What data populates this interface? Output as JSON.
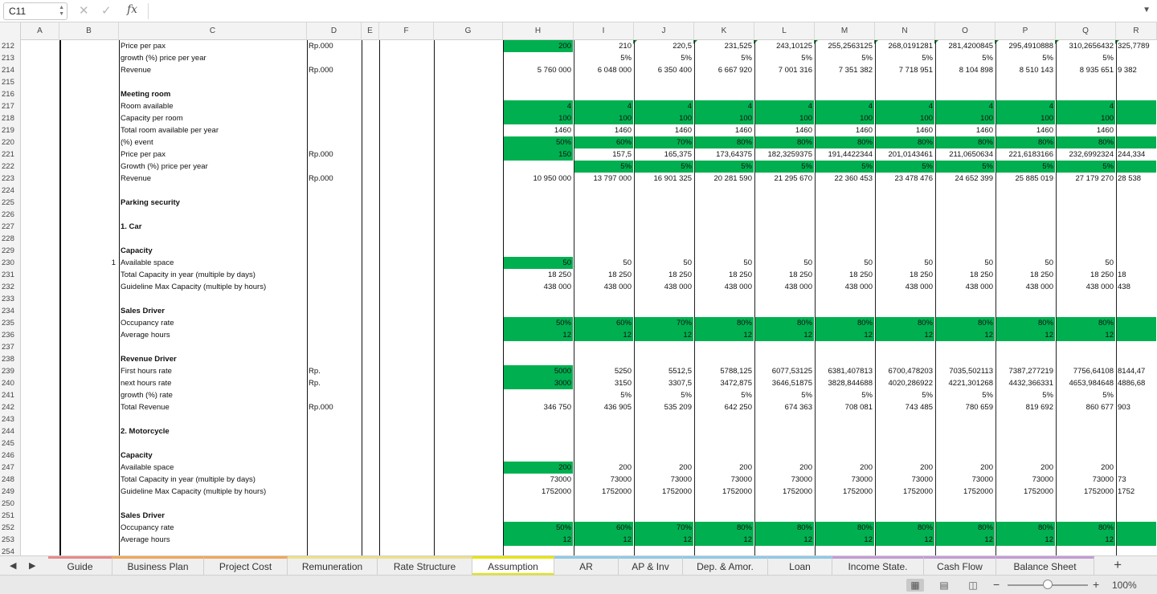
{
  "formula_bar": {
    "name_box": "C11",
    "formula": ""
  },
  "columns": [
    "A",
    "B",
    "C",
    "D",
    "E",
    "F",
    "G",
    "H",
    "I",
    "J",
    "K",
    "L",
    "M",
    "N",
    "O",
    "P",
    "Q",
    "R"
  ],
  "rows": [
    {
      "n": "212",
      "c": "Price per pax",
      "d": "Rp.000",
      "v": [
        "200",
        "210",
        "220,5",
        "231,525",
        "243,10125",
        "255,2563125",
        "268,0191281",
        "281,4200845",
        "295,4910888",
        "310,2656432",
        "325,7789"
      ],
      "g": [
        0
      ]
    },
    {
      "n": "213",
      "c": "growth (%) price per year",
      "v": [
        "",
        "5%",
        "5%",
        "5%",
        "5%",
        "5%",
        "5%",
        "5%",
        "5%",
        "5%",
        ""
      ]
    },
    {
      "n": "214",
      "c": "Revenue",
      "d": "Rp.000",
      "v": [
        "5 760 000",
        "6 048 000",
        "6 350 400",
        "6 667 920",
        "7 001 316",
        "7 351 382",
        "7 718 951",
        "8 104 898",
        "8 510 143",
        "8 935 651",
        "9 382"
      ]
    },
    {
      "n": "215"
    },
    {
      "n": "216",
      "c": "Meeting room",
      "bold": true
    },
    {
      "n": "217",
      "c": "Room available",
      "v": [
        "4",
        "4",
        "4",
        "4",
        "4",
        "4",
        "4",
        "4",
        "4",
        "4",
        ""
      ],
      "g": [
        0,
        1,
        2,
        3,
        4,
        5,
        6,
        7,
        8,
        9,
        10
      ]
    },
    {
      "n": "218",
      "c": "Capacity per room",
      "v": [
        "100",
        "100",
        "100",
        "100",
        "100",
        "100",
        "100",
        "100",
        "100",
        "100",
        ""
      ],
      "g": [
        0,
        1,
        2,
        3,
        4,
        5,
        6,
        7,
        8,
        9,
        10
      ]
    },
    {
      "n": "219",
      "c": "Total room available per year",
      "v": [
        "1460",
        "1460",
        "1460",
        "1460",
        "1460",
        "1460",
        "1460",
        "1460",
        "1460",
        "1460",
        ""
      ]
    },
    {
      "n": "220",
      "c": "(%) event",
      "v": [
        "50%",
        "60%",
        "70%",
        "80%",
        "80%",
        "80%",
        "80%",
        "80%",
        "80%",
        "80%",
        ""
      ],
      "g": [
        0,
        1,
        2,
        3,
        4,
        5,
        6,
        7,
        8,
        9,
        10
      ]
    },
    {
      "n": "221",
      "c": "Price per pax",
      "d": "Rp.000",
      "v": [
        "150",
        "157,5",
        "165,375",
        "173,64375",
        "182,3259375",
        "191,4422344",
        "201,0143461",
        "211,0650634",
        "221,6183166",
        "232,6992324",
        "244,334"
      ],
      "g": [
        0
      ]
    },
    {
      "n": "222",
      "c": "Growth (%) price per year",
      "v": [
        "",
        "5%",
        "5%",
        "5%",
        "5%",
        "5%",
        "5%",
        "5%",
        "5%",
        "5%",
        ""
      ],
      "g": [
        1,
        2,
        3,
        4,
        5,
        6,
        7,
        8,
        9,
        10
      ]
    },
    {
      "n": "223",
      "c": "Revenue",
      "d": "Rp.000",
      "v": [
        "10 950 000",
        "13 797 000",
        "16 901 325",
        "20 281 590",
        "21 295 670",
        "22 360 453",
        "23 478 476",
        "24 652 399",
        "25 885 019",
        "27 179 270",
        "28 538"
      ]
    },
    {
      "n": "224"
    },
    {
      "n": "225",
      "c": "Parking security",
      "bold": true
    },
    {
      "n": "226"
    },
    {
      "n": "227",
      "c": "1. Car",
      "bold": true
    },
    {
      "n": "228"
    },
    {
      "n": "229",
      "c": "Capacity",
      "bold": true
    },
    {
      "n": "230",
      "b": "1",
      "c": "Available space",
      "v": [
        "50",
        "50",
        "50",
        "50",
        "50",
        "50",
        "50",
        "50",
        "50",
        "50",
        ""
      ],
      "g": [
        0
      ]
    },
    {
      "n": "231",
      "c": "Total Capacity in year (multiple by days)",
      "v": [
        "18 250",
        "18 250",
        "18 250",
        "18 250",
        "18 250",
        "18 250",
        "18 250",
        "18 250",
        "18 250",
        "18 250",
        "18"
      ]
    },
    {
      "n": "232",
      "c": "Guideline Max Capacity (multiple by hours)",
      "v": [
        "438 000",
        "438 000",
        "438 000",
        "438 000",
        "438 000",
        "438 000",
        "438 000",
        "438 000",
        "438 000",
        "438 000",
        "438"
      ]
    },
    {
      "n": "233"
    },
    {
      "n": "234",
      "c": "Sales Driver",
      "bold": true
    },
    {
      "n": "235",
      "c": "Occupancy rate",
      "v": [
        "50%",
        "60%",
        "70%",
        "80%",
        "80%",
        "80%",
        "80%",
        "80%",
        "80%",
        "80%",
        ""
      ],
      "g": [
        0,
        1,
        2,
        3,
        4,
        5,
        6,
        7,
        8,
        9,
        10
      ]
    },
    {
      "n": "236",
      "c": "Average hours",
      "v": [
        "12",
        "12",
        "12",
        "12",
        "12",
        "12",
        "12",
        "12",
        "12",
        "12",
        ""
      ],
      "g": [
        0,
        1,
        2,
        3,
        4,
        5,
        6,
        7,
        8,
        9,
        10
      ]
    },
    {
      "n": "237"
    },
    {
      "n": "238",
      "c": "Revenue Driver",
      "bold": true
    },
    {
      "n": "239",
      "c": "First hours rate",
      "d": "Rp.",
      "v": [
        "5000",
        "5250",
        "5512,5",
        "5788,125",
        "6077,53125",
        "6381,407813",
        "6700,478203",
        "7035,502113",
        "7387,277219",
        "7756,64108",
        "8144,47"
      ],
      "g": [
        0
      ]
    },
    {
      "n": "240",
      "c": "next hours rate",
      "d": "Rp.",
      "v": [
        "3000",
        "3150",
        "3307,5",
        "3472,875",
        "3646,51875",
        "3828,844688",
        "4020,286922",
        "4221,301268",
        "4432,366331",
        "4653,984648",
        "4886,68"
      ],
      "g": [
        0
      ]
    },
    {
      "n": "241",
      "c": "growth (%) rate",
      "v": [
        "",
        "5%",
        "5%",
        "5%",
        "5%",
        "5%",
        "5%",
        "5%",
        "5%",
        "5%",
        ""
      ]
    },
    {
      "n": "242",
      "c": "Total Revenue",
      "d": "Rp.000",
      "v": [
        "346 750",
        "436 905",
        "535 209",
        "642 250",
        "674 363",
        "708 081",
        "743 485",
        "780 659",
        "819 692",
        "860 677",
        "903"
      ]
    },
    {
      "n": "243"
    },
    {
      "n": "244",
      "c": "2. Motorcycle",
      "bold": true
    },
    {
      "n": "245"
    },
    {
      "n": "246",
      "c": "Capacity",
      "bold": true
    },
    {
      "n": "247",
      "c": "Available space",
      "v": [
        "200",
        "200",
        "200",
        "200",
        "200",
        "200",
        "200",
        "200",
        "200",
        "200",
        ""
      ],
      "g": [
        0
      ]
    },
    {
      "n": "248",
      "c": "Total Capacity in year (multiple by days)",
      "v": [
        "73000",
        "73000",
        "73000",
        "73000",
        "73000",
        "73000",
        "73000",
        "73000",
        "73000",
        "73000",
        "73"
      ]
    },
    {
      "n": "249",
      "c": "Guideline Max Capacity (multiple by hours)",
      "v": [
        "1752000",
        "1752000",
        "1752000",
        "1752000",
        "1752000",
        "1752000",
        "1752000",
        "1752000",
        "1752000",
        "1752000",
        "1752"
      ]
    },
    {
      "n": "250"
    },
    {
      "n": "251",
      "c": "Sales Driver",
      "bold": true
    },
    {
      "n": "252",
      "c": "Occupancy rate",
      "v": [
        "50%",
        "60%",
        "70%",
        "80%",
        "80%",
        "80%",
        "80%",
        "80%",
        "80%",
        "80%",
        ""
      ],
      "g": [
        0,
        1,
        2,
        3,
        4,
        5,
        6,
        7,
        8,
        9,
        10
      ]
    },
    {
      "n": "253",
      "c": "Average hours",
      "v": [
        "12",
        "12",
        "12",
        "12",
        "12",
        "12",
        "12",
        "12",
        "12",
        "12",
        ""
      ],
      "g": [
        0,
        1,
        2,
        3,
        4,
        5,
        6,
        7,
        8,
        9,
        10
      ]
    },
    {
      "n": "254"
    }
  ],
  "sheet_tabs": [
    {
      "label": "Guide",
      "color": "#e88a8a"
    },
    {
      "label": "Business Plan",
      "color": "#f2a65a"
    },
    {
      "label": "Project Cost",
      "color": "#f2a65a"
    },
    {
      "label": "Remuneration",
      "color": "#f0e08a"
    },
    {
      "label": "Rate Structure",
      "color": "#f0e08a"
    },
    {
      "label": "Assumption",
      "color": "#e6e600",
      "active": true
    },
    {
      "label": "AR",
      "color": "#8ecae6"
    },
    {
      "label": "AP & Inv",
      "color": "#8ecae6"
    },
    {
      "label": "Dep. & Amor.",
      "color": "#8ecae6"
    },
    {
      "label": "Loan",
      "color": "#8ecae6"
    },
    {
      "label": "Income State.",
      "color": "#c39bd3"
    },
    {
      "label": "Cash Flow",
      "color": "#c39bd3"
    },
    {
      "label": "Balance Sheet",
      "color": "#c39bd3"
    }
  ],
  "status_bar": {
    "zoom": "100%"
  }
}
